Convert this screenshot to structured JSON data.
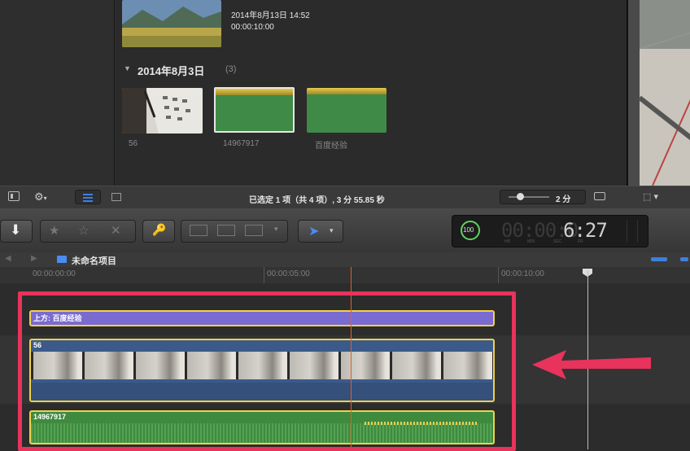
{
  "browser": {
    "clip_top": {
      "date": "2014年8月13日 14:52",
      "duration": "00:00:10:00"
    },
    "event_group": {
      "title": "2014年8月3日",
      "count": "(3)"
    },
    "clips": [
      {
        "name": "56"
      },
      {
        "name": "14967917"
      },
      {
        "name": "百度经验"
      }
    ],
    "status": "已选定 1 项（共 4 项）, 3 分 55.85 秒",
    "zoom_label": "2 分"
  },
  "toolbar": {
    "timecode": "6:27",
    "timecode_prefix": "00:00:0",
    "timecode_units": [
      "HR",
      "MIN",
      "SEC",
      "FR"
    ],
    "percent_badge": "100"
  },
  "timeline": {
    "project_name": "未命名项目",
    "ruler_ticks": [
      "00:00:00:00",
      "00:00:05:00",
      "00:00:10:00"
    ],
    "title_clip": "上方: 百度经验",
    "video_clip": "56",
    "audio_clip": "14967917"
  },
  "colors": {
    "highlight_box": "#e8335c",
    "arrow": "#e8335c",
    "title_clip": "#7a6bd0",
    "video_clip": "#3b5a8a",
    "audio_clip": "#3e8a3e",
    "selection_border": "#f1d24a",
    "playhead": "#e0602a"
  }
}
